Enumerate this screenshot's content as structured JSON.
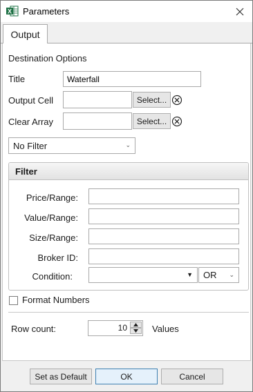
{
  "window": {
    "title": "Parameters",
    "app_icon": "excel-icon",
    "close_icon": "close-icon"
  },
  "tabs": [
    {
      "label": "Output",
      "selected": true
    }
  ],
  "destination": {
    "section_label": "Destination Options",
    "title_label": "Title",
    "title_value": "Waterfall",
    "output_cell_label": "Output Cell",
    "output_cell_value": "",
    "clear_array_label": "Clear Array",
    "clear_array_value": "",
    "select_label": "Select...",
    "clear_icon": "circle-x-icon"
  },
  "filter_dropdown": {
    "selected": "No Filter"
  },
  "filter_group": {
    "header": "Filter",
    "price_label": "Price/Range:",
    "price_value": "",
    "value_label": "Value/Range:",
    "value_value": "",
    "size_label": "Size/Range:",
    "size_value": "",
    "broker_label": "Broker ID:",
    "broker_value": "",
    "condition_label": "Condition:",
    "condition_value": "",
    "logic_value": "OR"
  },
  "format_numbers": {
    "label": "Format Numbers",
    "checked": false
  },
  "row_count": {
    "label": "Row count:",
    "value": "10",
    "suffix": "Values"
  },
  "footer": {
    "set_default": "Set as Default",
    "ok": "OK",
    "cancel": "Cancel"
  },
  "colors": {
    "excel_green": "#1e7145",
    "ok_border": "#3c7fb1"
  }
}
